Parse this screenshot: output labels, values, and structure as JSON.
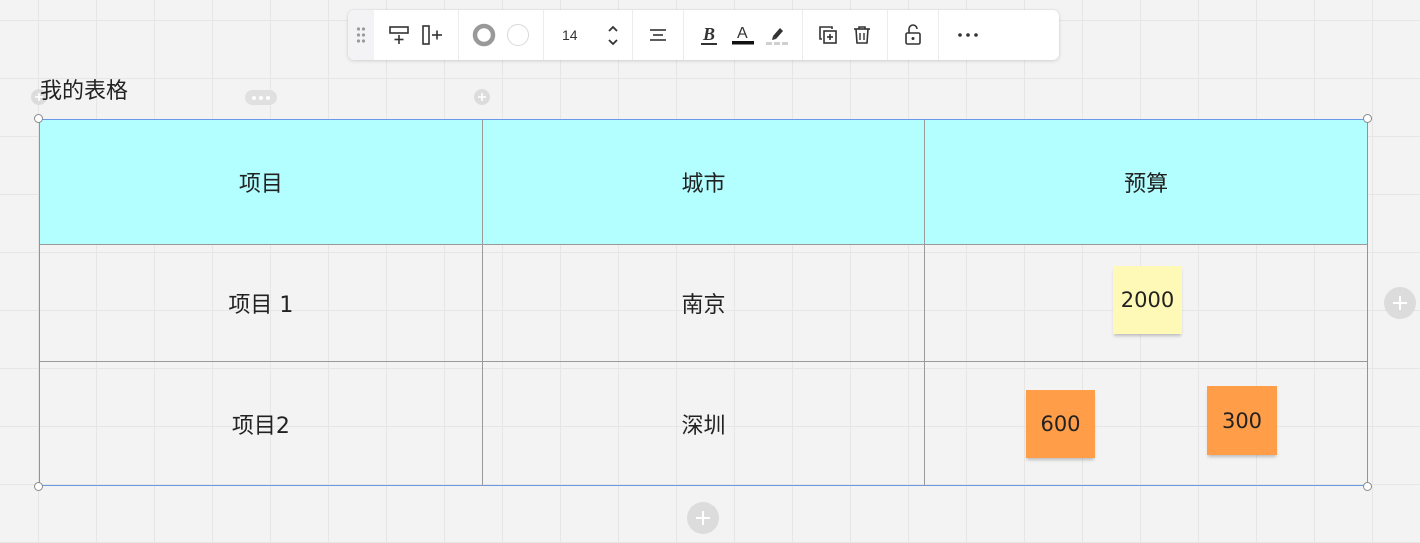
{
  "toolbar": {
    "drag_handle_icon": "drag-dots-icon",
    "insert_row_icon": "insert-row-icon",
    "insert_column_icon": "insert-column-icon",
    "border_color": "#999999",
    "fill_color": "#ffffff",
    "font_size": "14",
    "align_icon": "align-center-icon",
    "bold_icon": "bold-icon",
    "text_color_icon": "text-color-icon",
    "text_color": "#111111",
    "highlight_icon": "highlight-pen-icon",
    "duplicate_icon": "duplicate-icon",
    "delete_icon": "trash-icon",
    "lock_icon": "unlock-icon",
    "more_icon": "more-horizontal-icon"
  },
  "table_title": "我的表格",
  "table": {
    "header_color": "#b3feff",
    "border_accent": "#6a9ae6",
    "headers": [
      "项目",
      "城市",
      "预算"
    ],
    "rows": [
      [
        "项目 1",
        "南京",
        ""
      ],
      [
        "项目2",
        "深圳",
        ""
      ]
    ]
  },
  "stickies": {
    "s1": {
      "text": "2000",
      "color": "#fff9b7"
    },
    "s2": {
      "text": "600",
      "color": "#ff9d48"
    },
    "s3": {
      "text": "300",
      "color": "#ff9d48"
    }
  }
}
